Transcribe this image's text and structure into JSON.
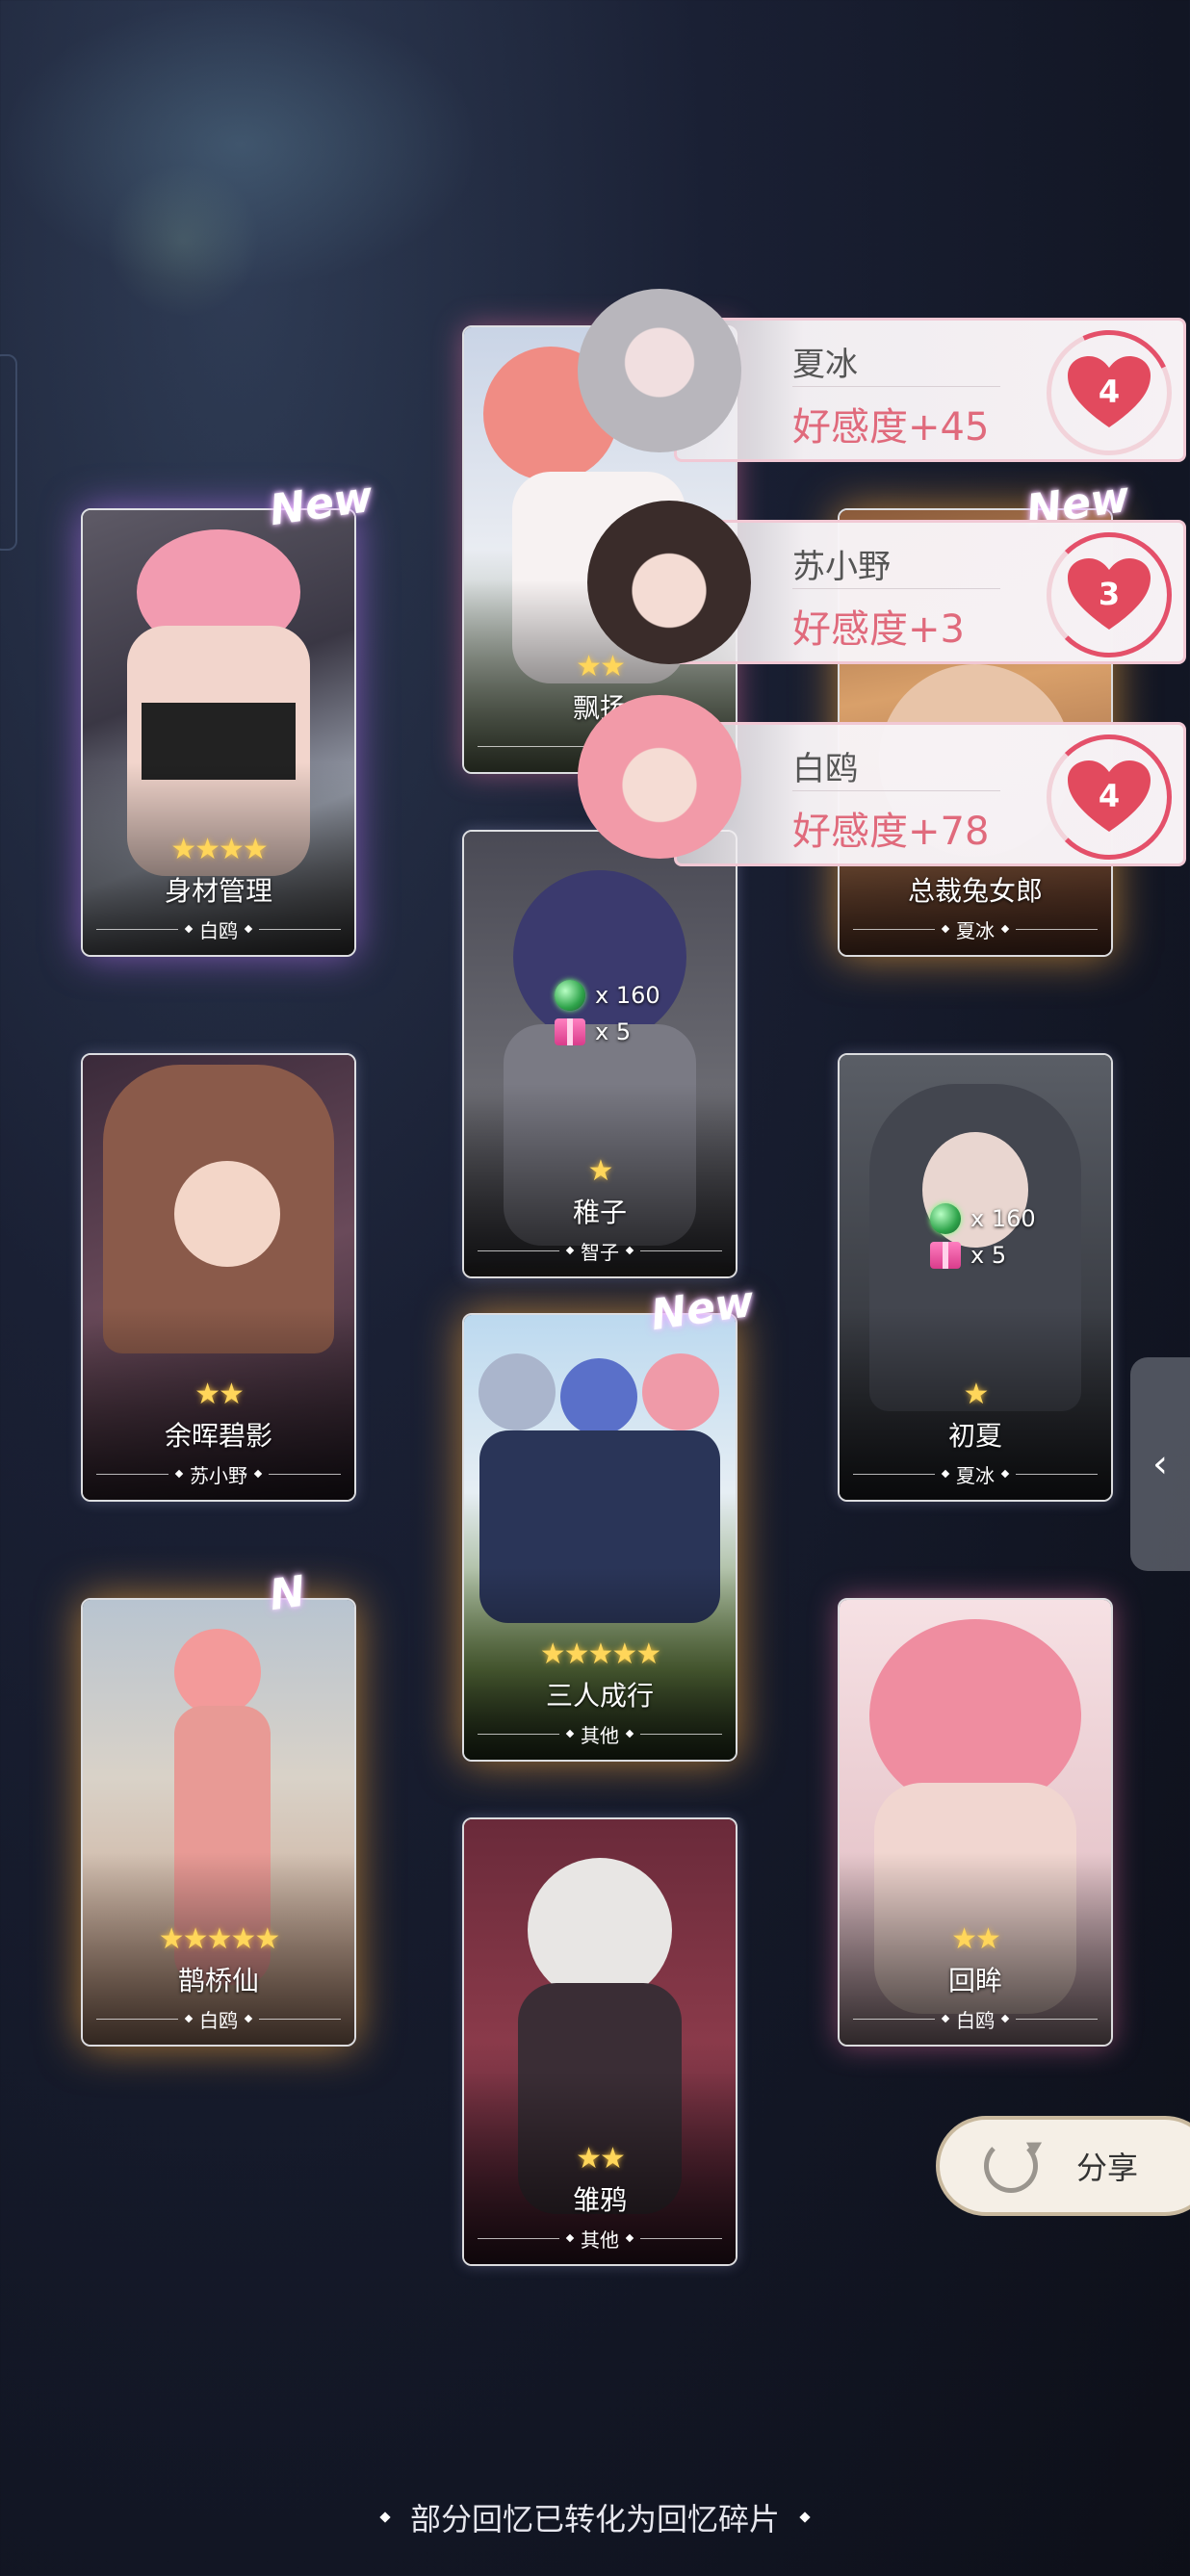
{
  "cards": [
    {
      "title": "身材管理",
      "owner": "白鸥",
      "stars": "★★★★",
      "new_label": "New"
    },
    {
      "title": "飘扬",
      "owner": "白",
      "stars": "★★"
    },
    {
      "title": "总裁兔女郎",
      "owner": "夏冰",
      "new_label": "New"
    },
    {
      "title": "稚子",
      "owner": "智子",
      "stars": "★"
    },
    {
      "title": "余晖碧影",
      "owner": "苏小野",
      "stars": "★★"
    },
    {
      "title": "初夏",
      "owner": "夏冰",
      "stars": "★"
    },
    {
      "title": "三人成行",
      "owner": "其他",
      "stars": "★★★★★",
      "new_label": "New"
    },
    {
      "title": "鹊桥仙",
      "owner": "白鸥",
      "stars": "★★★★★",
      "new_label": "N"
    },
    {
      "title": "回眸",
      "owner": "白鸥",
      "stars": "★★"
    },
    {
      "title": "雏鸦",
      "owner": "其他",
      "stars": "★★"
    }
  ],
  "rewards": {
    "zhizi": {
      "gem_count": "x 160",
      "gift_count": "x 5"
    },
    "chuxia": {
      "gem_count": "x 160",
      "gift_count": "x 5"
    }
  },
  "affinity": [
    {
      "name": "夏冰",
      "delta": "好感度+45",
      "level": "4",
      "progress": 0.3
    },
    {
      "name": "苏小野",
      "delta": "好感度+3",
      "level": "3",
      "progress": 0.7
    },
    {
      "name": "白鸥",
      "delta": "好感度+78",
      "level": "4",
      "progress": 0.55
    }
  ],
  "share_label": "分享",
  "footer_note": "部分回忆已转化为回忆碎片",
  "colors": {
    "accent_pink": "#e06a7c",
    "star_gold": "#ffd65a"
  }
}
